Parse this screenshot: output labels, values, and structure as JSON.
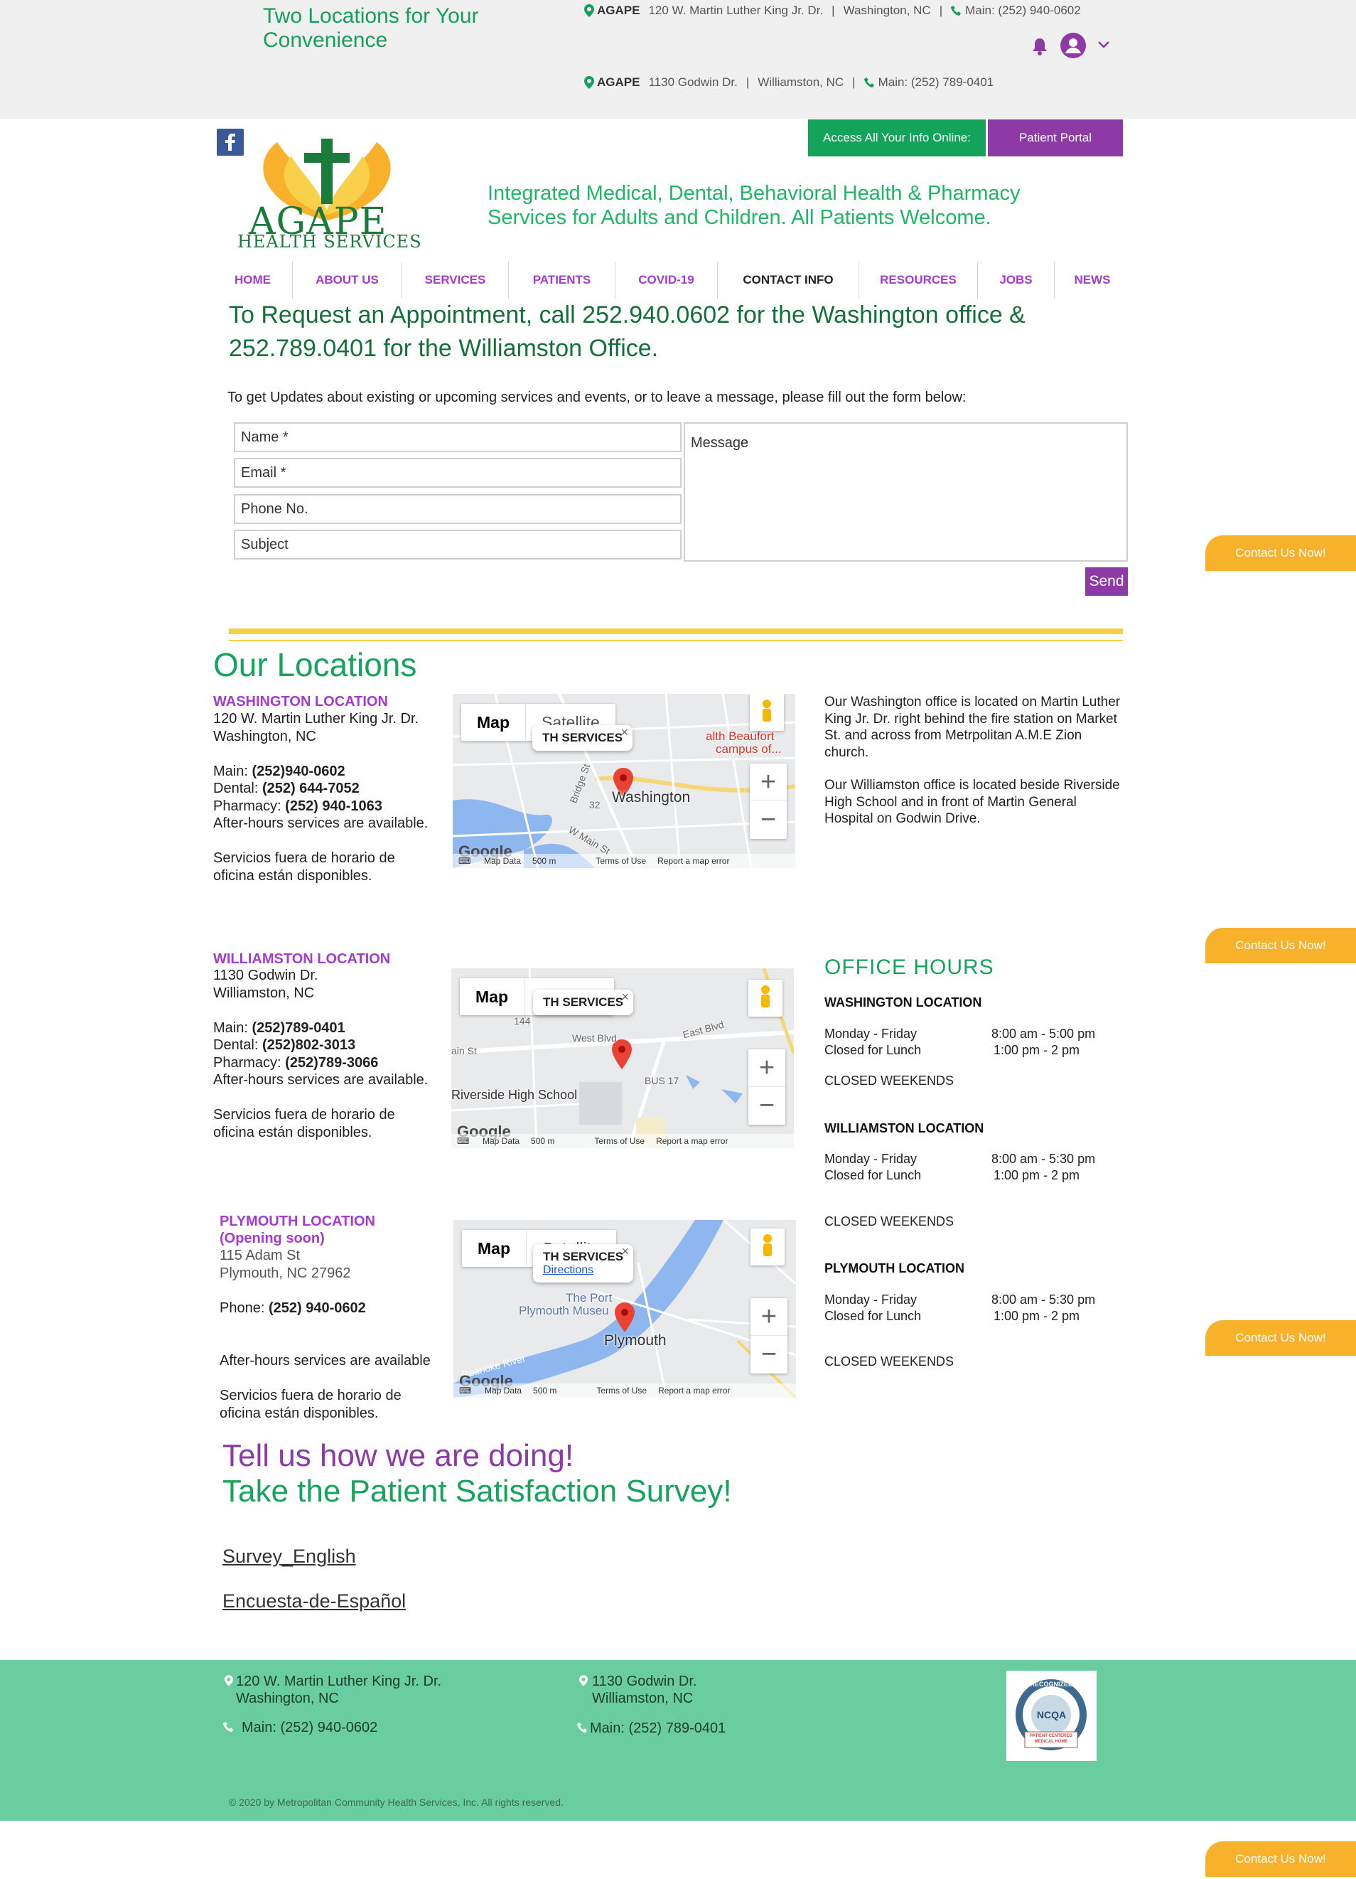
{
  "topbar": {
    "tagline": "Two Locations for Your Convenience",
    "line1": {
      "brand": "AGAPE",
      "address": "120 W. Martin Luther King Jr. Dr.",
      "city": "Washington, NC",
      "phone": "Main: (252) 940-0602"
    },
    "line2": {
      "brand": "AGAPE",
      "address": "1130 Godwin Dr.",
      "city": "Williamston, NC",
      "phone": "Main: (252) 789-0401"
    },
    "sep": "|"
  },
  "header": {
    "logo_word": "AGAPE",
    "logo_sub": "HEALTH SERVICES",
    "tagline": "Integrated Medical, Dental, Behavioral Health & Pharmacy Services for Adults and Children. All Patients Welcome.",
    "access_label": "Access All Your Info Online:",
    "portal_label": "Patient Portal"
  },
  "nav": {
    "items": [
      "HOME",
      "ABOUT US",
      "SERVICES",
      "PATIENTS",
      "COVID-19",
      "CONTACT INFO",
      "RESOURCES",
      "JOBS",
      "NEWS"
    ]
  },
  "appointment": "To Request an Appointment, call 252.940.0602 for the Washington office & 252.789.0401 for the Williamston Office.",
  "form": {
    "intro": "To get Updates about existing or upcoming services and events, or to leave a message, please fill out the form below:",
    "name_placeholder": "Name *",
    "email_placeholder": "Email *",
    "phone_placeholder": "Phone No.",
    "subject_placeholder": "Subject",
    "message_placeholder": "Message",
    "send_label": "Send"
  },
  "locations": {
    "heading": "Our Locations",
    "washington": {
      "title": "WASHINGTON LOCATION",
      "address1": "120 W. Martin Luther King Jr. Dr.",
      "address2": "Washington, NC",
      "main_label": "Main: ",
      "main": "(252)940-0602",
      "dental_label": "Dental: ",
      "dental": "(252) 644-7052",
      "pharmacy_label": "Pharmacy: ",
      "pharmacy": "(252) 940-1063",
      "after_hours": "After-hours services are available.",
      "spanish1": "Servicios fuera de horario de",
      "spanish2": "oficina están disponibles."
    },
    "williamston": {
      "title": "WILLIAMSTON LOCATION",
      "address1": "1130 Godwin Dr.",
      "address2": "Williamston, NC",
      "main_label": "Main: ",
      "main": "(252)789-0401",
      "dental_label": "Dental: ",
      "dental": "(252)802-3013",
      "pharmacy_label": "Pharmacy: ",
      "pharmacy": "(252)789-3066",
      "after_hours": "After-hours services are available.",
      "spanish1": "Servicios fuera de horario de",
      "spanish2": "oficina están disponibles."
    },
    "plymouth": {
      "title": "PLYMOUTH LOCATION",
      "subtitle": "(Opening soon)",
      "address1": "115 Adam St",
      "address2": "Plymouth, NC 27962",
      "phone_label": "Phone: ",
      "phone": "(252) 940-0602",
      "after_hours": "After-hours services are available",
      "spanish1": "Servicios fuera de horario de",
      "spanish2": "oficina están disponibles."
    },
    "side_text1": "Our Washington office is located on Martin Luther King Jr. Dr. right behind the fire station on Market St. and across from Metrpolitan A.M.E Zion church.",
    "side_text2": "Our Williamston office is located beside Riverside High School and in front of Martin General Hospital on Godwin Drive."
  },
  "maps": {
    "map_label": "Map",
    "satellite_label": "Satellite",
    "info_title": "TH SERVICES",
    "directions": "Directions",
    "footer": [
      "Map Data",
      "500 m",
      "Terms of Use",
      "Report a map error"
    ],
    "google": "Google",
    "close": "×",
    "plus": "+",
    "minus": "−",
    "washington": {
      "city": "Washington",
      "poi": "alth Beaufort",
      "poi2": "campus of...",
      "road1": "Bridge St",
      "road2": "W Main St",
      "shield": "32",
      "bus": "BUS 17"
    },
    "williamston": {
      "school": "Riverside High School",
      "road1": "West Blvd",
      "road2": "East Blvd",
      "road3": "ain St",
      "shield": "144",
      "bus": "BUS 17"
    },
    "plymouth": {
      "city": "Plymouth",
      "poi": "The Port",
      "poi2": "Plymouth Museu",
      "river": "Roanoke River"
    }
  },
  "office_hours": {
    "title": "OFFICE HOURS",
    "locations": [
      {
        "name": "WASHINGTON LOCATION",
        "weekday": "Monday - Friday",
        "weekday_time": "8:00 am - 5:00 pm",
        "lunch": "Closed for Lunch",
        "lunch_time": "1:00 pm - 2 pm",
        "weekends": "CLOSED WEEKENDS"
      },
      {
        "name": "WILLIAMSTON LOCATION",
        "weekday": "Monday - Friday",
        "weekday_time": "8:00 am - 5:30 pm",
        "lunch": "Closed for Lunch",
        "lunch_time": "1:00 pm - 2 pm",
        "weekends": "CLOSED WEEKENDS"
      },
      {
        "name": "PLYMOUTH LOCATION",
        "weekday": "Monday - Friday",
        "weekday_time": "8:00 am - 5:30 pm",
        "lunch": "Closed for Lunch",
        "lunch_time": "1:00 pm - 2 pm",
        "weekends": "CLOSED WEEKENDS"
      }
    ]
  },
  "contact_tab": "Contact Us Now!",
  "survey": {
    "line1": "Tell us how we are doing!",
    "line2": "Take the Patient Satisfaction Survey!",
    "english": "Survey_English",
    "spanish": "Encuesta-de-Español"
  },
  "footer": {
    "addr1_line1": "120 W. Martin Luther King Jr. Dr.",
    "addr1_line2": "Washington, NC",
    "phone1": "Main: (252) 940-0602",
    "addr2_line1": "1130 Godwin Dr.",
    "addr2_line2": "Williamston, NC",
    "phone2": "Main: (252) 789-0401",
    "copyright": "© 2020 by Metropolitan Community Health Services, Inc. All rights reserved.",
    "badge_top": "RECOGNIZED",
    "badge_mid": "NCQA",
    "badge_bottom": "PATIENT-CENTERED MEDICAL HOME"
  },
  "colors": {
    "green": "#16a35c",
    "purple": "#8e3aa6",
    "yellow": "#f7b12a",
    "footer": "#69cda0"
  }
}
